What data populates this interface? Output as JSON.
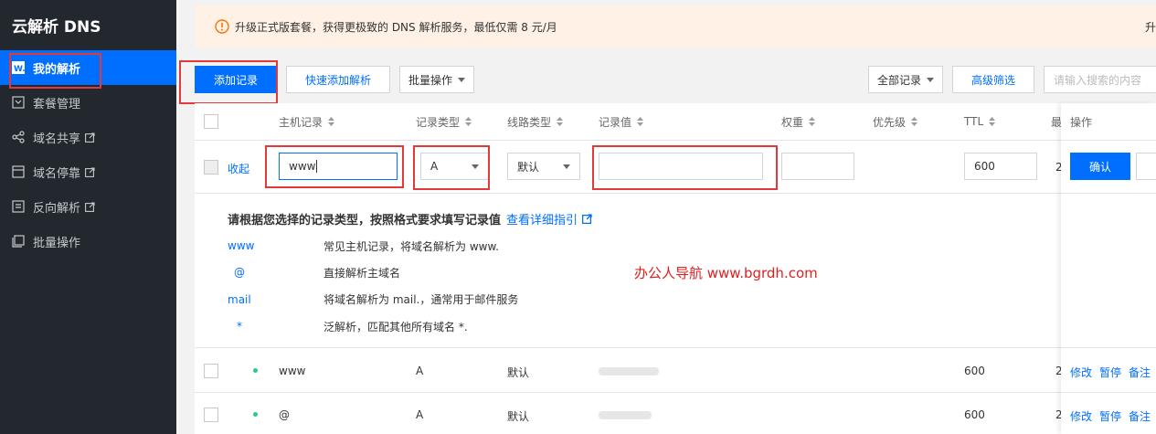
{
  "sidebar": {
    "title": "云解析 DNS",
    "items": [
      {
        "label": "我的解析",
        "icon": "w-icon",
        "active": true,
        "external": false
      },
      {
        "label": "套餐管理",
        "icon": "package-icon",
        "active": false,
        "external": false
      },
      {
        "label": "域名共享",
        "icon": "share-icon",
        "active": false,
        "external": true
      },
      {
        "label": "域名停靠",
        "icon": "parking-icon",
        "active": false,
        "external": true
      },
      {
        "label": "反向解析",
        "icon": "reverse-icon",
        "active": false,
        "external": true
      },
      {
        "label": "批量操作",
        "icon": "batch-icon",
        "active": false,
        "external": false
      }
    ]
  },
  "notice": {
    "text": "升级正式版套餐，获得更极致的 DNS 解析服务，最低仅需 8 元/月",
    "right_text": "升"
  },
  "toolbar": {
    "add_record": "添加记录",
    "quick_add": "快速添加解析",
    "batch_ops": "批量操作",
    "all_records": "全部记录",
    "advanced_filter": "高级筛选",
    "search_placeholder": "请输入搜索的内容"
  },
  "table": {
    "headers": {
      "host": "主机记录",
      "type": "记录类型",
      "line": "线路类型",
      "value": "记录值",
      "weight": "权重",
      "priority": "优先级",
      "ttl": "TTL",
      "ops": "操作",
      "extra": "最"
    },
    "edit_row": {
      "collapse": "收起",
      "host": "www",
      "type": "A",
      "line": "默认",
      "value": "",
      "weight": "",
      "ttl": "600",
      "extra": "2",
      "confirm": "确认"
    },
    "guide": {
      "title": "请根据您选择的记录类型，按照格式要求填写记录值",
      "link": "查看详细指引",
      "rows": [
        {
          "key": "www",
          "desc": "常见主机记录，将域名解析为 www."
        },
        {
          "key": "@",
          "desc": "直接解析主域名"
        },
        {
          "key": "mail",
          "desc": "将域名解析为 mail.，通常用于邮件服务"
        },
        {
          "key": "*",
          "desc": "泛解析，匹配其他所有域名 *."
        }
      ]
    },
    "watermark": "办公人导航 www.bgrdh.com",
    "rows": [
      {
        "host": "www",
        "type": "A",
        "line": "默认",
        "ttl": "600",
        "extra": "2",
        "ops": [
          "修改",
          "暂停",
          "备注"
        ]
      },
      {
        "host": "@",
        "type": "A",
        "line": "默认",
        "ttl": "600",
        "extra": "2",
        "ops": [
          "修改",
          "暂停",
          "备注"
        ]
      }
    ]
  },
  "colors": {
    "sidebar_bg": "#22282e",
    "primary": "#006eff",
    "highlight_box": "#e23a3a",
    "notice_bg": "#fff1e5",
    "status_dot": "#29cc85"
  }
}
